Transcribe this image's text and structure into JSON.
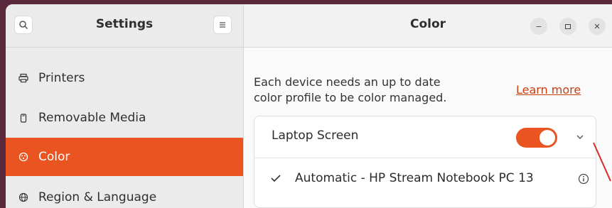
{
  "sidebar": {
    "title": "Settings",
    "items": [
      {
        "label": "Printers",
        "icon": "printer-icon"
      },
      {
        "label": "Removable Media",
        "icon": "removable-media-icon"
      },
      {
        "label": "Color",
        "icon": "color-icon"
      },
      {
        "label": "Region & Language",
        "icon": "globe-icon"
      }
    ]
  },
  "main": {
    "title": "Color",
    "description": "Each device needs an up to date\ncolor profile to be color managed.",
    "learn_more": "Learn more",
    "device": {
      "name": "Laptop Screen",
      "enabled": true,
      "profile": "Automatic - HP Stream Notebook PC 13"
    }
  },
  "colors": {
    "accent": "#e95420",
    "link": "#c34113"
  }
}
